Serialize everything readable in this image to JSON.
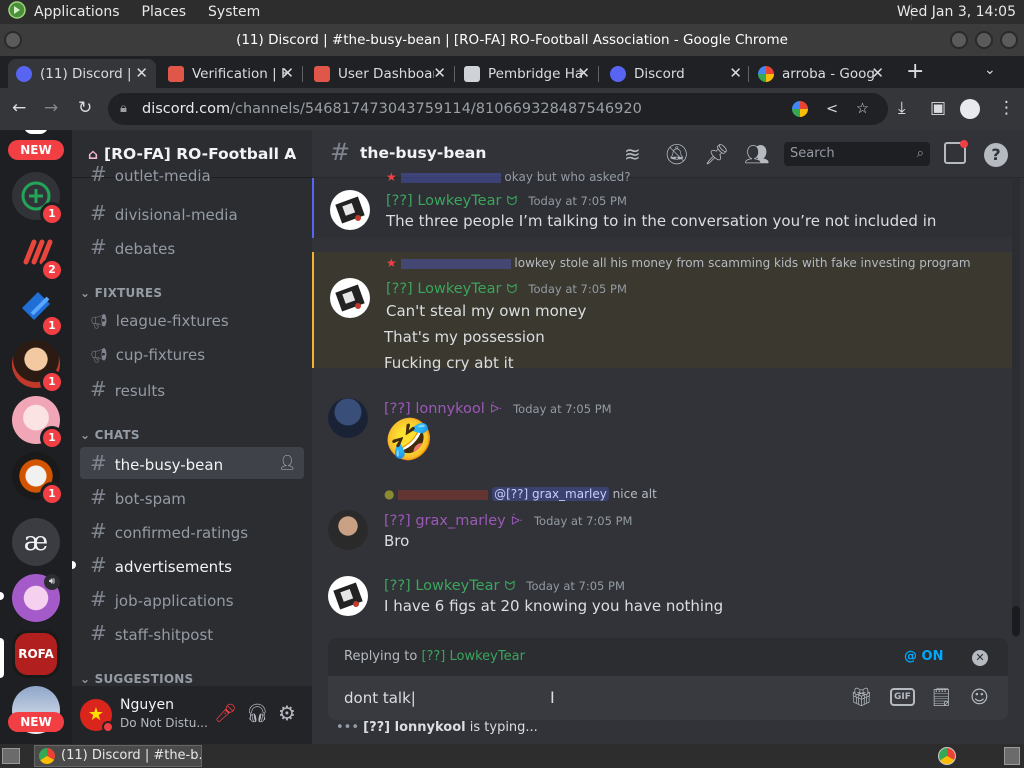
{
  "os_panel": {
    "applications": "Applications",
    "places": "Places",
    "system": "System",
    "clock": "Wed Jan  3, 14:05"
  },
  "window": {
    "title": "(11) Discord | #the-busy-bean | [RO-FA] RO-Football Association - Google Chrome"
  },
  "tabs": [
    {
      "label": "(11) Discord | #",
      "active": true
    },
    {
      "label": "Verification | H",
      "active": false
    },
    {
      "label": "User Dashboard",
      "active": false
    },
    {
      "label": "Pembridge Ha",
      "active": false
    },
    {
      "label": "Discord",
      "active": false
    },
    {
      "label": "arroba - Goog",
      "active": false
    }
  ],
  "address_bar": {
    "host": "discord.com",
    "path": "/channels/546817473043759114/810669328487546920"
  },
  "servers": {
    "new_label": "NEW",
    "badges": [
      "1",
      "2",
      "1",
      "1",
      "1",
      "1"
    ],
    "ae_label": "æ",
    "rofa_label": "ROFA"
  },
  "guild": {
    "name": "[RO-FA] RO-Football A"
  },
  "channels": {
    "top": [
      {
        "name": "outlet-media"
      },
      {
        "name": "divisional-media"
      },
      {
        "name": "debates"
      }
    ],
    "fixtures_category": "FIXTURES",
    "fixtures": [
      {
        "name": "league-fixtures"
      },
      {
        "name": "cup-fixtures"
      },
      {
        "name": "results"
      }
    ],
    "chats_category": "CHATS",
    "chats": [
      {
        "name": "the-busy-bean"
      },
      {
        "name": "bot-spam"
      },
      {
        "name": "confirmed-ratings"
      },
      {
        "name": "advertisements"
      },
      {
        "name": "job-applications"
      },
      {
        "name": "staff-shitpost"
      }
    ],
    "suggestions_category": "SUGGESTIONS"
  },
  "user": {
    "name": "Nguyen",
    "status": "Do Not Distu..."
  },
  "chat_header": {
    "channel": "the-busy-bean",
    "search_placeholder": "Search"
  },
  "messages": [
    {
      "reply_text": "okay but who asked?",
      "author": "[??] LowkeyTear",
      "time": "Today at 7:05 PM",
      "lines": [
        "The three people I’m talking to in the conversation you’re not included in"
      ]
    },
    {
      "reply_text": "lowkey stole all his money from scamming kids with fake investing program",
      "author": "[??] LowkeyTear",
      "time": "Today at 7:05 PM",
      "lines": [
        "Can't steal my own money",
        "That's my possession",
        "Fucking cry abt it"
      ]
    },
    {
      "author": "[??] lonnykool",
      "time": "Today at 7:05 PM",
      "emoji": "🤣"
    },
    {
      "reply_mention": "@[??] grax_marley",
      "reply_text": "nice alt",
      "author": "[??] grax_marley",
      "time": "Today at 7:05 PM",
      "lines": [
        "Bro"
      ]
    },
    {
      "author": "[??] LowkeyTear",
      "time": "Today at 7:05 PM",
      "lines": [
        "I have 6 figs at 20 knowing you have nothing"
      ]
    }
  ],
  "composer": {
    "replying_to_prefix": "Replying to ",
    "replying_to_user": "[??] LowkeyTear",
    "mention_toggle": "@ ON",
    "value": "dont talk",
    "gif_label": "GIF",
    "typing_user": "[??] lonnykool",
    "typing_suffix": " is typing..."
  },
  "taskbar": {
    "window_label": "(11) Discord | #the-b..."
  },
  "colors": {
    "lowkey_green": "#3ba55c",
    "purple_role": "#9b59b6",
    "blurple": "#5865f2",
    "red": "#f23f43"
  }
}
